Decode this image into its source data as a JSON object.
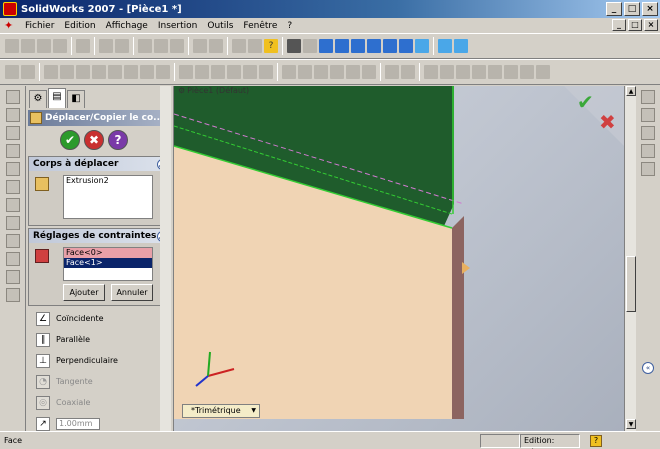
{
  "window": {
    "title": "SolidWorks 2007 - [Pièce1 *]",
    "controls": [
      "_",
      "□",
      "×"
    ]
  },
  "menu": {
    "items": [
      "Fichier",
      "Edition",
      "Affichage",
      "Insertion",
      "Outils",
      "Fenêtre",
      "?"
    ],
    "doc_controls": [
      "_",
      "□",
      "×"
    ]
  },
  "property_manager": {
    "tabs": [
      "feature-manager",
      "property-manager",
      "configuration-manager"
    ],
    "title": "Déplacer/Copier le co...",
    "bodies_section": {
      "header": "Corps à déplacer",
      "items": [
        "Extrusion2"
      ]
    },
    "constraints_section": {
      "header": "Réglages de contraintes",
      "faces": [
        "Face<0>",
        "Face<1>"
      ],
      "add_button": "Ajouter",
      "cancel_button": "Annuler"
    },
    "constraint_types": [
      {
        "label": "Coïncidente",
        "icon": "coincident-icon",
        "enabled": true
      },
      {
        "label": "Parallèle",
        "icon": "parallel-icon",
        "enabled": true
      },
      {
        "label": "Perpendiculaire",
        "icon": "perpendicular-icon",
        "enabled": true
      },
      {
        "label": "Tangente",
        "icon": "tangent-icon",
        "enabled": false
      },
      {
        "label": "Coaxiale",
        "icon": "coaxial-icon",
        "enabled": false
      }
    ],
    "distance_value": "1.00mm"
  },
  "viewport": {
    "tree_label": "Pièce1 (Défaut)",
    "view_tab": "*Trimétrique",
    "colors": {
      "top_face": "#1f5c2c",
      "front_face": "#f0d4b4",
      "side_face": "#8c6460",
      "edge_highlight": "#33cc33"
    }
  },
  "status": {
    "left": "Face",
    "mode": "Edition: Pièce",
    "help": "?"
  }
}
